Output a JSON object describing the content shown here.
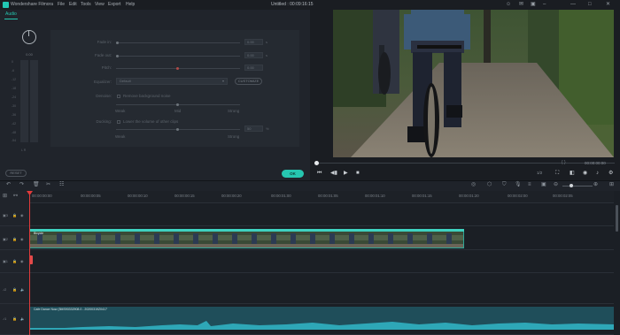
{
  "app": {
    "name": "Wondershare Filmora",
    "window_title": "Untitled : 00:09:16:15",
    "menu": [
      "File",
      "Edit",
      "Tools",
      "View",
      "Export",
      "Help"
    ]
  },
  "audio_panel": {
    "tab_label": "Audio",
    "knob_value": "0.00",
    "meter_scale": [
      "0",
      "-6",
      "-12",
      "-18",
      "-24",
      "-30",
      "-36",
      "-42",
      "-48",
      "-54"
    ],
    "meter_lr": "L R",
    "fade_in": {
      "label": "Fade in:",
      "value": "0.00",
      "unit": "s"
    },
    "fade_out": {
      "label": "Fade out:",
      "value": "0.00",
      "unit": "s"
    },
    "pitch": {
      "label": "Pitch:",
      "value": "0.00"
    },
    "equalizer": {
      "label": "Equalizer:",
      "value": "Default",
      "customize_label": "CUSTOMIZE"
    },
    "denoise": {
      "label": "Denoise:",
      "option": "Remove background noise",
      "levels": [
        "Weak",
        "Mid",
        "Strong"
      ]
    },
    "ducking": {
      "label": "Ducking:",
      "option": "Lower the volume of other clips",
      "value": "50",
      "unit": "%",
      "levels": [
        "Weak",
        "Strong"
      ]
    },
    "reset_label": "RESET",
    "ok_label": "OK"
  },
  "preview": {
    "timecode": "00:00:00:00",
    "zoom_ratio": "1/2",
    "brackets": "{ }"
  },
  "timeline": {
    "ticks": [
      "00:00:00:00",
      "00:00:00:05",
      "00:00:00:10",
      "00:00:00:15",
      "00:00:00:20",
      "00:00:01:00",
      "00:00:01:05",
      "00:00:01:10",
      "00:00:01:15",
      "00:00:01:20",
      "00:00:02:00",
      "00:00:02:05"
    ],
    "video_clip_name": "Bicycle",
    "audio_clip_name": "Cafe Dance Now (5MS90332908.0 - 20200319Z0417"
  },
  "colors": {
    "accent": "#26c6b0",
    "playhead": "#e23b3b",
    "background": "#1b1f25"
  }
}
